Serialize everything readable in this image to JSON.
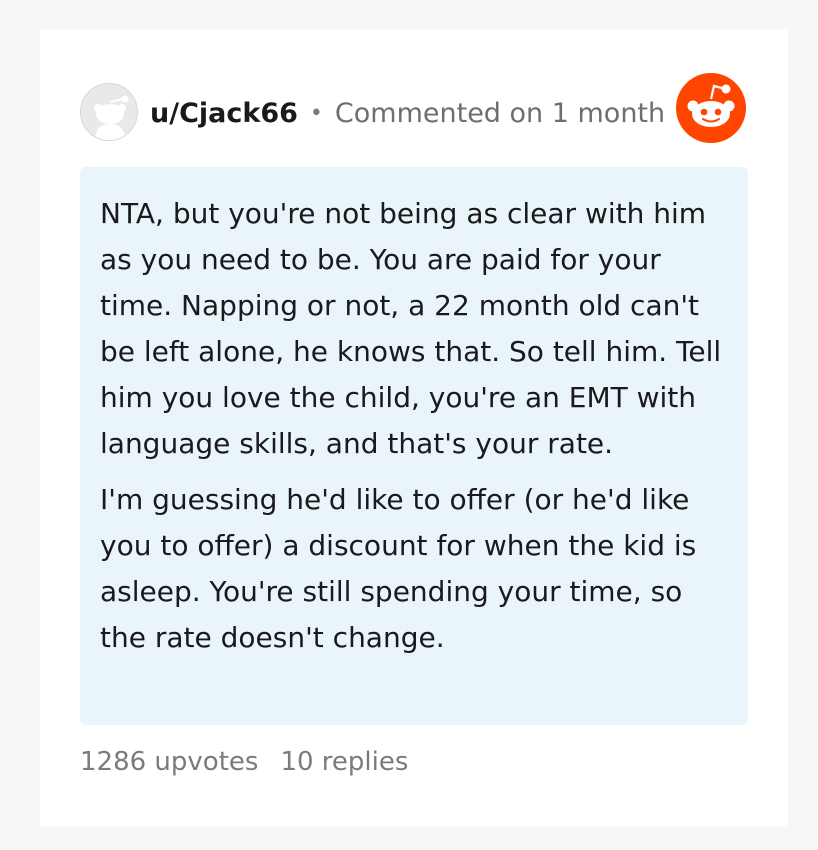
{
  "comment": {
    "username": "u/Cjack66",
    "separator": "•",
    "timestamp": "Commented on 1 month",
    "paragraphs": [
      "NTA, but you're not being as clear with him as you need to be. You are paid for your time. Napping or not, a 22 month old can't be left alone, he knows that. So tell him. Tell him you love the child, you're an EMT with language skills, and that's your rate.",
      "I'm guessing he'd like to offer (or he'd like you to offer) a discount for when the kid is asleep. You're still spending your time, so the rate doesn't change."
    ],
    "upvotes": "1286 upvotes",
    "replies": "10 replies"
  },
  "colors": {
    "reddit_orange": "#ff4500",
    "comment_bg": "#eaf4fb"
  },
  "icons": {
    "avatar": "default-avatar-icon",
    "brand": "reddit-snoo-icon"
  }
}
